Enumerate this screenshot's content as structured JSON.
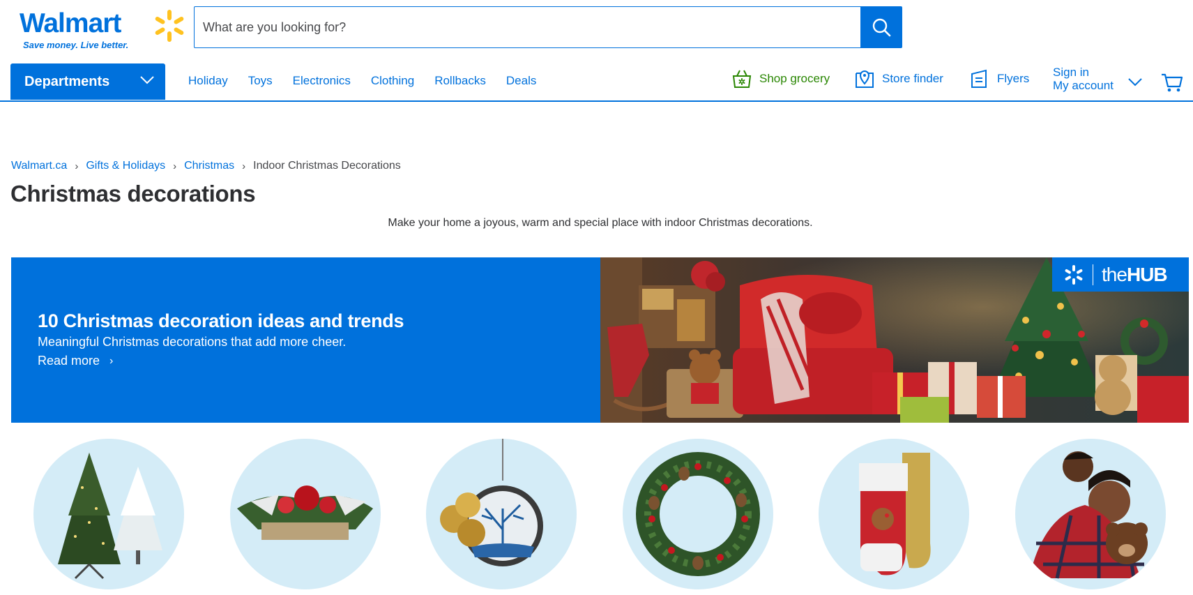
{
  "brand": {
    "name": "Walmart",
    "tagline": "Save money. Live better.",
    "blue": "#0071dc",
    "spark_yellow": "#ffc220",
    "grocery_green": "#2a8703"
  },
  "search": {
    "placeholder": "What are you looking for?",
    "icon": "search-icon"
  },
  "nav": {
    "departments_label": "Departments",
    "links": [
      "Holiday",
      "Toys",
      "Electronics",
      "Clothing",
      "Rollbacks",
      "Deals"
    ],
    "shop_grocery": "Shop grocery",
    "store_finder": "Store finder",
    "flyers": "Flyers",
    "sign_in": "Sign in",
    "my_account": "My account"
  },
  "breadcrumb": [
    "Walmart.ca",
    "Gifts & Holidays",
    "Christmas",
    "Indoor Christmas Decorations"
  ],
  "page": {
    "title": "Christmas decorations",
    "description": "Make your home a joyous, warm and special place with indoor Christmas decorations."
  },
  "banner": {
    "title": "10 Christmas decoration ideas and trends",
    "subtitle": "Meaningful Christmas decorations that add more cheer.",
    "link": "Read more",
    "badge_the": "the",
    "badge_hub": "HUB"
  },
  "categories": [
    {
      "icon": "christmas-trees-image"
    },
    {
      "icon": "centerpiece-image"
    },
    {
      "icon": "ornaments-image"
    },
    {
      "icon": "wreath-image"
    },
    {
      "icon": "stockings-image"
    },
    {
      "icon": "pajamas-image"
    }
  ]
}
